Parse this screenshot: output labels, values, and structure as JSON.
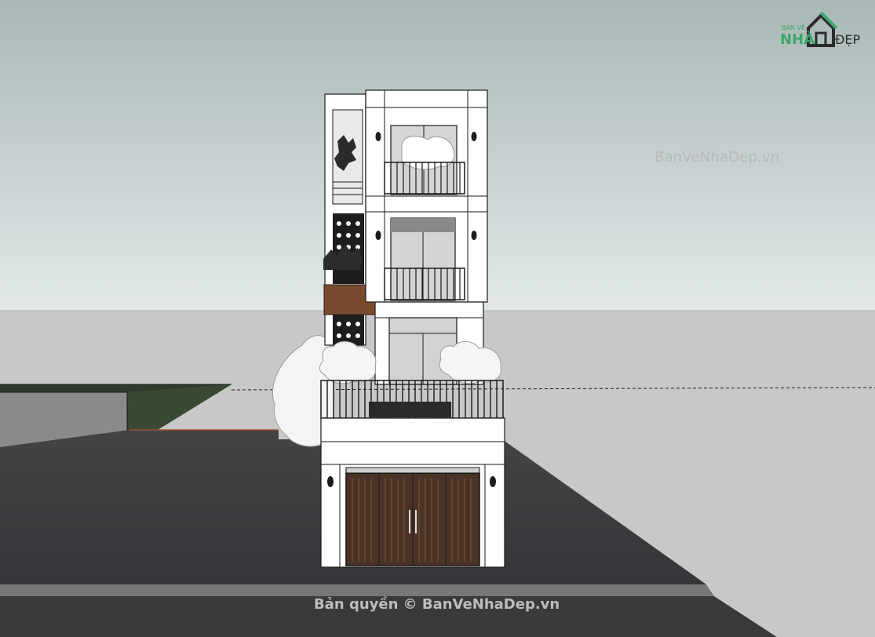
{
  "watermark": {
    "site": "BanVeNhaDep.vn",
    "copyright": "Bản quyền © BanVeNhaDep.vn"
  },
  "logo": {
    "line1": "BẢN VẼ",
    "line2a": "NHÀ",
    "line2b": "ĐẸP"
  },
  "colors": {
    "sky_top": "#aebbbb",
    "sky_bottom": "#e0e6e6",
    "ground": "#c7c7c7",
    "road": "#3f3f41",
    "curb": "#7a7a7a",
    "wall": "#ffffff",
    "outline": "#1a1a1a",
    "door_wood": "#4a3326",
    "planter_wood": "#7a4a2e",
    "glass": "#cfcfcf",
    "logo_green": "#3aa96a",
    "logo_dark": "#2b2b2b"
  }
}
